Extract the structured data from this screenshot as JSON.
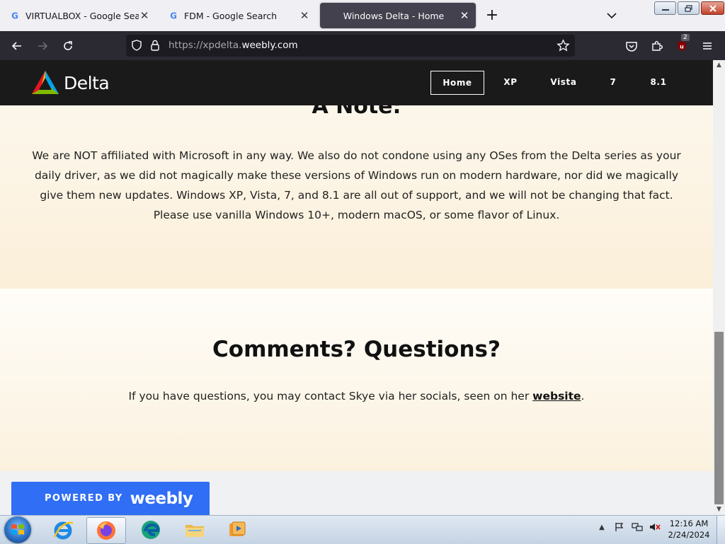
{
  "browser": {
    "tabs": [
      {
        "title": "VIRTUALBOX - Google Search",
        "favicon": "google-icon",
        "active": false
      },
      {
        "title": "FDM - Google Search",
        "favicon": "google-icon",
        "active": false
      },
      {
        "title": "Windows Delta - Home",
        "favicon": "",
        "active": true
      }
    ],
    "url_scheme": "https://",
    "url_sub": "xpdelta.",
    "url_domain": "weebly.com",
    "extension_badge": "2"
  },
  "site": {
    "logo_text": "Delta",
    "menu": [
      "Home",
      "XP",
      "Vista",
      "7",
      "8.1"
    ],
    "active_menu": "Home"
  },
  "note": {
    "title": "A Note:",
    "body": "We are NOT affiliated with Microsoft in any way. We also do not condone using any OSes from the Delta series as your daily driver, as we did not magically make these versions of Windows run on modern hardware, nor did we magically give them new updates. Windows XP, Vista, 7, and 8.1 are all out of support, and we will not be changing that fact. Please use vanilla Windows 10+, modern macOS, or some flavor of Linux."
  },
  "comments": {
    "title": "Comments? Questions?",
    "body_prefix": "If you have questions, you may contact Skye via her socials, seen on her ",
    "link_text": "website",
    "body_suffix": "."
  },
  "footer": {
    "powered_by": "POWERED BY",
    "brand": "weebly"
  },
  "taskbar": {
    "time": "12:16 AM",
    "date": "2/24/2024",
    "apps": [
      "internet-explorer-icon",
      "firefox-icon",
      "edge-icon",
      "file-explorer-icon",
      "media-player-icon"
    ]
  },
  "colors": {
    "accent": "#2f6ef5",
    "header_bg": "#1a1a1a",
    "browser_toolbar": "#2b2a33"
  }
}
